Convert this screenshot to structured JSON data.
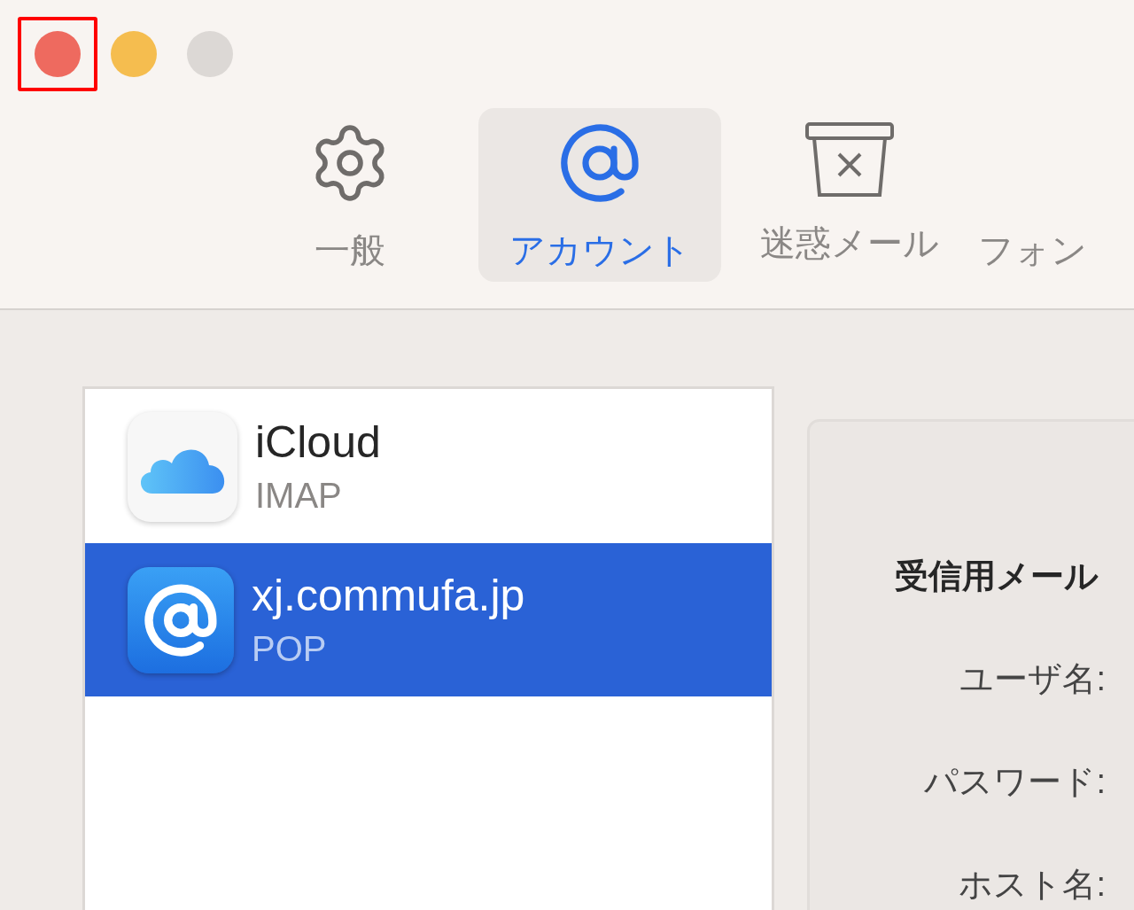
{
  "window_controls": [
    {
      "kind": "close",
      "highlighted": true
    },
    {
      "kind": "minimize",
      "highlighted": false
    },
    {
      "kind": "zoom",
      "highlighted": false
    }
  ],
  "tabs": [
    {
      "kind": "general",
      "label": "一般",
      "selected": false
    },
    {
      "kind": "accounts",
      "label": "アカウント",
      "selected": true
    },
    {
      "kind": "junk",
      "label": "迷惑メール",
      "selected": false
    },
    {
      "kind": "fonts",
      "label": "フォン",
      "selected": false
    }
  ],
  "accounts": [
    {
      "kind": "icloud",
      "name": "iCloud",
      "type": "IMAP",
      "selected": false
    },
    {
      "kind": "mail",
      "name": "xj.commufa.jp",
      "type": "POP",
      "selected": true
    }
  ],
  "server_settings": {
    "heading": "受信用メール",
    "labels": [
      "ユーザ名:",
      "パスワード:",
      "ホスト名:"
    ]
  }
}
